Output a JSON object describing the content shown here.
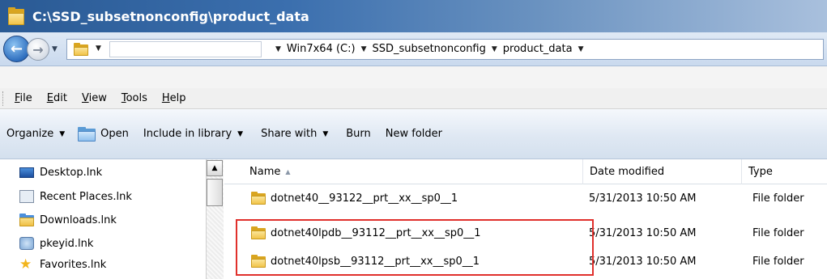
{
  "window": {
    "title": "C:\\SSD_subsetnonconfig\\product_data"
  },
  "nav": {
    "address_input_value": "",
    "breadcrumbs": [
      "Win7x64 (C:)",
      "SSD_subsetnonconfig",
      "product_data"
    ]
  },
  "menu": {
    "file": "File",
    "edit": "Edit",
    "view": "View",
    "tools": "Tools",
    "help": "Help"
  },
  "commands": {
    "organize": "Organize",
    "open": "Open",
    "include_in_library": "Include in library",
    "share_with": "Share with",
    "burn": "Burn",
    "new_folder": "New folder"
  },
  "navpane": {
    "items": [
      {
        "label": "Desktop.lnk",
        "icon": "desktop-icon"
      },
      {
        "label": "Recent Places.lnk",
        "icon": "recent-places-icon"
      },
      {
        "label": "Downloads.lnk",
        "icon": "downloads-icon"
      },
      {
        "label": "pkeyid.lnk",
        "icon": "shortcut-icon"
      },
      {
        "label": "Favorites.lnk",
        "icon": "star-icon"
      }
    ]
  },
  "filelist": {
    "columns": {
      "name": "Name",
      "date_modified": "Date modified",
      "type": "Type"
    },
    "rows": [
      {
        "name": "dotnet40__93122__prt__xx__sp0__1",
        "date": "5/31/2013 10:50 AM",
        "type": "File folder"
      },
      {
        "name": "dotnet40lpdb__93112__prt__xx__sp0__1",
        "date": "5/31/2013 10:50 AM",
        "type": "File folder"
      },
      {
        "name": "dotnet40lpsb__93112__prt__xx__sp0__1",
        "date": "5/31/2013 10:50 AM",
        "type": "File folder"
      }
    ]
  },
  "colors": {
    "highlight_box": "#e0302c",
    "titlebar": "#2a5a94"
  }
}
